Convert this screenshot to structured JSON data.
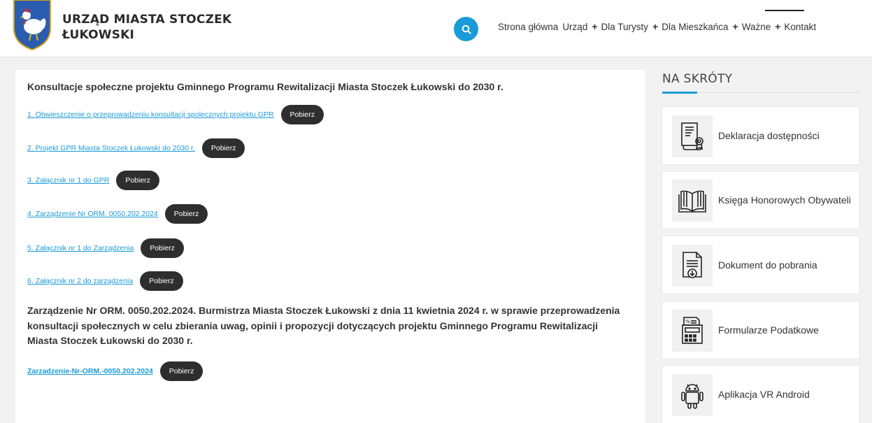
{
  "header": {
    "title_line1": "URZĄD MIASTA STOCZEK",
    "title_line2": "ŁUKOWSKI",
    "nav": [
      {
        "label": "Strona główna",
        "has_plus": false
      },
      {
        "label": "Urząd",
        "has_plus": true
      },
      {
        "label": "Dla Turysty",
        "has_plus": true
      },
      {
        "label": "Dla Mieszkańca",
        "has_plus": true
      },
      {
        "label": "Ważne",
        "has_plus": true
      },
      {
        "label": "Kontakt",
        "has_plus": false
      }
    ],
    "search_icon": "search-icon",
    "accent_color": "#1a9bd7"
  },
  "main": {
    "section_title": "Konsultacje społeczne projektu Gminnego Programu Rewitalizacji Miasta Stoczek Łukowski do 2030 r.",
    "documents": [
      {
        "label": "1. Obwieszczenie o przeprowadzeniu konsultacji spolecznych projektu GPR",
        "button": "Pobierz"
      },
      {
        "label": "2. Projekt GPR Miasta Stoczek Łukowski do 2030 r.",
        "button": "Pobierz"
      },
      {
        "label": "3. Załącznik nr 1 do GPR",
        "button": "Pobierz"
      },
      {
        "label": "4. Zarządzenie Nr ORM. 0050.202.2024",
        "button": "Pobierz"
      },
      {
        "label": "5. Załącznik nr 1 do Zarządzenia",
        "button": "Pobierz"
      },
      {
        "label": "6. Załącznik nr 2 do zarządzenia",
        "button": "Pobierz"
      }
    ],
    "order_text": "Zarządzenie Nr ORM. 0050.202.2024. Burmistrza Miasta Stoczek Łukowski z dnia 11 kwietnia 2024 r. w sprawie przeprowadzenia konsultacji społecznych w celu zbierania uwag, opinii i propozycji dotyczących projektu Gminnego Programu Rewitalizacji Miasta Stoczek Łukowski do 2030 r.",
    "order_link": {
      "label": "Zarzadzenie-Nr-ORM.-0050.202.2024",
      "button": "Pobierz"
    }
  },
  "sidebar": {
    "title": "NA SKRÓTY",
    "items": [
      {
        "label": "Deklaracja dostępności",
        "icon": "certificate-icon"
      },
      {
        "label": "Księga Honorowych Obywateli",
        "icon": "book-icon"
      },
      {
        "label": "Dokument do pobrania",
        "icon": "document-download-icon"
      },
      {
        "label": "Formularze Podatkowe",
        "icon": "calculator-icon"
      },
      {
        "label": "Aplikacja VR Android",
        "icon": "android-icon"
      }
    ]
  }
}
